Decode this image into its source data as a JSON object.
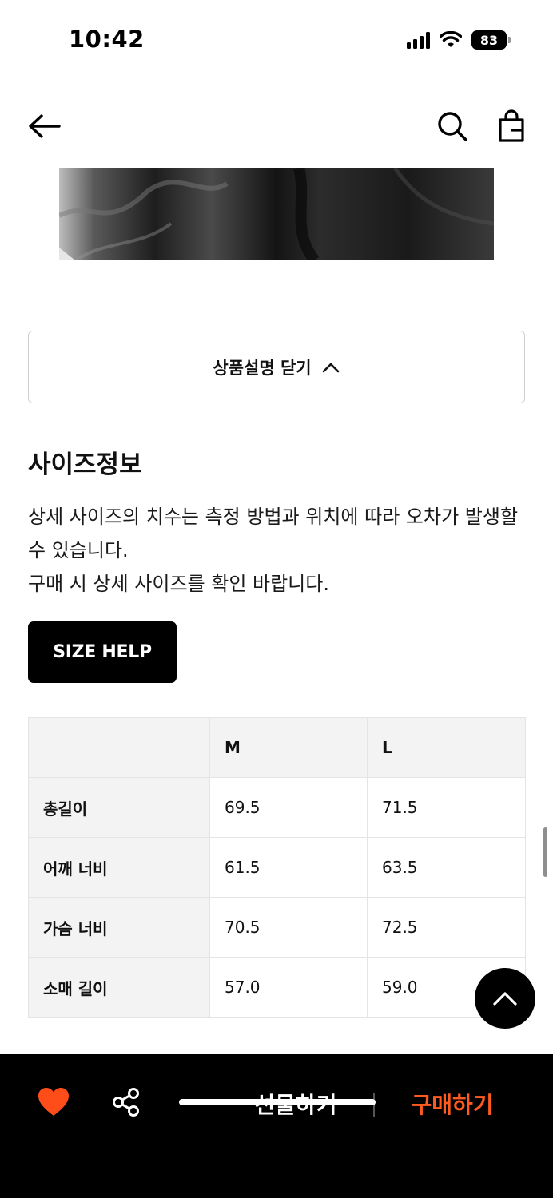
{
  "status_bar": {
    "time": "10:42",
    "battery": "83"
  },
  "description": {
    "close_label": "상품설명 닫기"
  },
  "size_info": {
    "title": "사이즈정보",
    "desc_line1": "상세 사이즈의 치수는 측정 방법과 위치에 따라 오차가 발생할 수 있습니다.",
    "desc_line2": "구매 시 상세 사이즈를 확인 바랍니다.",
    "help_label": "SIZE HELP"
  },
  "size_table": {
    "columns": [
      "",
      "M",
      "L"
    ],
    "rows": [
      {
        "label": "총길이",
        "values": [
          "69.5",
          "71.5"
        ]
      },
      {
        "label": "어깨 너비",
        "values": [
          "61.5",
          "63.5"
        ]
      },
      {
        "label": "가슴 너비",
        "values": [
          "70.5",
          "72.5"
        ]
      },
      {
        "label": "소매 길이",
        "values": [
          "57.0",
          "59.0"
        ]
      }
    ]
  },
  "bottom_bar": {
    "gift_label": "선물하기",
    "buy_label": "구매하기",
    "accent_color": "#ff5a1f",
    "heart_color": "#ff4d1a"
  },
  "icons": [
    "back-arrow-icon",
    "search-icon",
    "shopping-bag-icon",
    "chevron-up-icon",
    "heart-icon",
    "share-icon",
    "wifi-icon",
    "signal-icon",
    "battery-icon"
  ]
}
